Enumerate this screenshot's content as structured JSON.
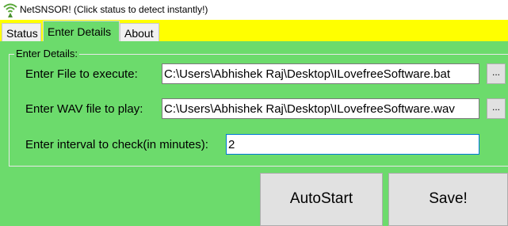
{
  "window": {
    "title": "NetSNSOR! (Click status to detect instantly!)",
    "icon": "wifi-signal-icon"
  },
  "tabs": [
    {
      "label": "Status",
      "active": false
    },
    {
      "label": "Enter Details",
      "active": true
    },
    {
      "label": "About",
      "active": false
    }
  ],
  "details": {
    "group_label": "Enter Details:",
    "file_label": "Enter File to execute:",
    "file_value": "C:\\Users\\Abhishek Raj\\Desktop\\ILovefreeSoftware.bat",
    "wav_label": "Enter WAV file to play:",
    "wav_value": "C:\\Users\\Abhishek Raj\\Desktop\\ILovefreeSoftware.wav",
    "interval_label": "Enter interval to check(in minutes):",
    "interval_value": "2",
    "browse_label": "..."
  },
  "buttons": {
    "autostart": "AutoStart",
    "save": "Save!"
  },
  "colors": {
    "panel_bg": "#6cdb6c",
    "tabstrip_bg": "#ffff00",
    "focus_border": "#0078d7"
  }
}
